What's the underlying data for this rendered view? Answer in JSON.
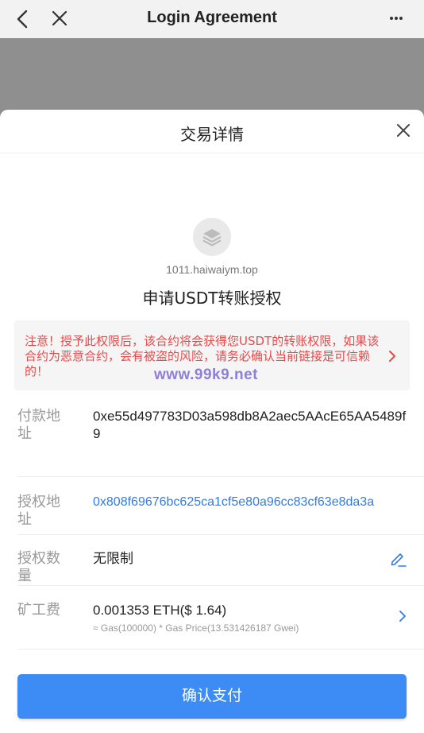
{
  "topbar": {
    "title": "Login Agreement"
  },
  "sheet": {
    "title": "交易详情",
    "domain": "1011.haiwaiym.top",
    "request": "申请USDT转账授权",
    "warning": "注意！授予此权限后，该合约将会获得您USDT的转账权限，如果该合约为恶意合约，会有被盗的风险，请务必确认当前链接是可信赖的！",
    "watermark": "www.99k9.net",
    "rows": {
      "payer": {
        "label": "付款地址",
        "value": "0xe55d497783D03a598db8A2aec5AAcE65AA5489f9"
      },
      "spender": {
        "label": "授权地址",
        "value": "0x808f69676bc625ca1cf5e80a96cc83cf63e8da3a"
      },
      "amount": {
        "label": "授权数量",
        "value": "无限制"
      },
      "fee": {
        "label": "矿工费",
        "value": "0.001353 ETH($ 1.64)",
        "detail": "≈ Gas(100000) * Gas Price(13.531426187 Gwei)"
      }
    },
    "confirm_label": "确认支付"
  },
  "colors": {
    "accent": "#3d8bf5",
    "link": "#2f7ce8",
    "warning": "#e84a4a"
  },
  "icons": [
    "back-arrow-icon",
    "close-icon",
    "more-icon",
    "layers-icon",
    "chevron-right-icon",
    "edit-icon"
  ]
}
